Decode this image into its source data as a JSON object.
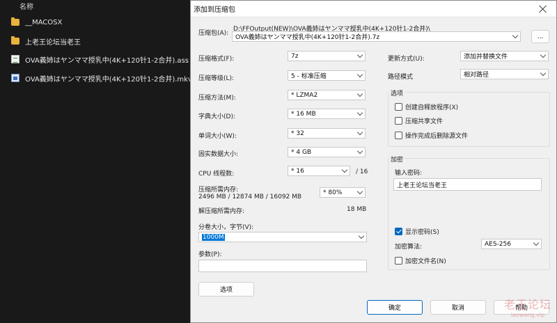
{
  "explorer": {
    "column_header": "名称",
    "files": [
      {
        "name": "__MACOSX",
        "icon": "folder-icon"
      },
      {
        "name": "上老王论坛当老王",
        "icon": "folder-icon"
      },
      {
        "name": "OVA義姉はヤンママ授乳中(4K+120针1-2合并).ass",
        "icon": "subtitle-file-icon"
      },
      {
        "name": "OVA義姉はヤンママ授乳中(4K+120针1-2合并).mkv",
        "icon": "video-file-icon"
      }
    ]
  },
  "dialog": {
    "title": "添加到压缩包",
    "archive_label": "压缩包(A):",
    "archive_path": "D:\\FFOutput(NEW)\\OVA義姉はヤンママ授乳中(4K+120针1-2合并)\\",
    "archive_name": "OVA義姉はヤンママ授乳中(4K+120针1-2合并).7z",
    "browse_label": "...",
    "format_label": "压缩格式(F):",
    "format_value": "7z",
    "level_label": "压缩等级(L):",
    "level_value": "5 - 标准压缩",
    "method_label": "压缩方法(M):",
    "method_value": "* LZMA2",
    "dict_label": "字典大小(D):",
    "dict_value": "* 16 MB",
    "word_label": "单词大小(W):",
    "word_value": "* 32",
    "solid_label": "固实数据大小:",
    "solid_value": "* 4 GB",
    "cpu_label": "CPU 线程数:",
    "cpu_value": "* 16",
    "cpu_total": "/ 16",
    "mem_comp_label": "压缩所需内存:",
    "mem_comp_value": "2496 MB / 12874 MB / 16092 MB",
    "mem_pct_value": "* 80%",
    "mem_decomp_label": "解压缩所需内存:",
    "mem_decomp_value": "18 MB",
    "split_label": "分卷大小，字节(V):",
    "split_value": "1000M",
    "params_label": "参数(P):",
    "params_value": "",
    "options_button": "选项",
    "update_label": "更新方式(U):",
    "update_value": "添加并替换文件",
    "pathmode_label": "路径模式",
    "pathmode_value": "相对路径",
    "options_group": "选项",
    "opt_sfx": "创建自释放程序(X)",
    "opt_shared": "压缩共享文件",
    "opt_delete": "操作完成后删除源文件",
    "encrypt_group": "加密",
    "password_label": "输入密码:",
    "password_value": "上老王论坛当老王",
    "show_password": "显示密码(S)",
    "enc_method_label": "加密算法:",
    "enc_method_value": "AES-256",
    "encrypt_names": "加密文件名(N)",
    "ok_button": "确定",
    "cancel_button": "取消",
    "help_button": "帮助"
  },
  "watermark": {
    "text": "老王论坛",
    "url": "laowang.vip"
  }
}
